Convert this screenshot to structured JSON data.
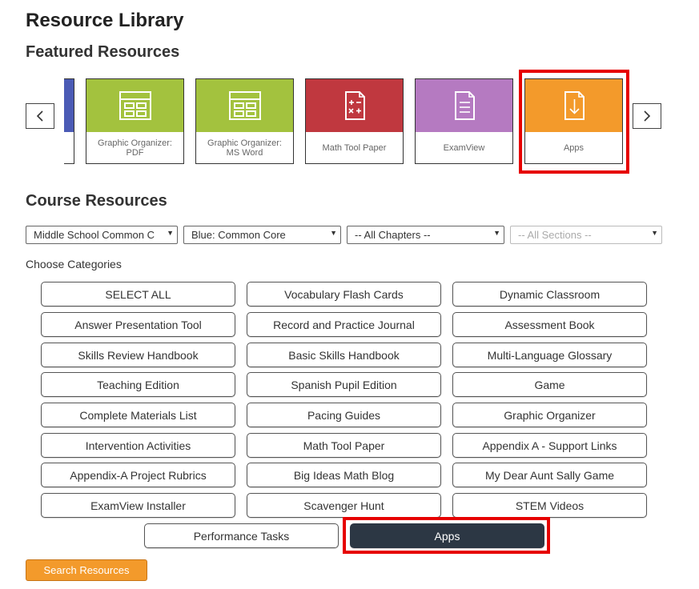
{
  "header": {
    "title": "Resource Library",
    "featured_title": "Featured Resources",
    "course_title": "Course Resources"
  },
  "featured": {
    "tiles": [
      {
        "label": "Graphic Organizer: PDF",
        "color": "#a3c23e",
        "icon": "table-grid-icon"
      },
      {
        "label": "Graphic Organizer: MS Word",
        "color": "#a3c23e",
        "icon": "table-grid-icon"
      },
      {
        "label": "Math Tool Paper",
        "color": "#c0383f",
        "icon": "math-operators-icon"
      },
      {
        "label": "ExamView",
        "color": "#b57ac1",
        "icon": "document-lines-icon"
      },
      {
        "label": "Apps",
        "color": "#f39a2b",
        "icon": "download-icon"
      }
    ],
    "partial_tile_color": "#4b5bb5"
  },
  "filters": {
    "course": "Middle School Common C",
    "program": "Blue: Common Core",
    "chapter": "-- All Chapters --",
    "section": "-- All Sections --"
  },
  "categories": {
    "label": "Choose Categories",
    "buttons": [
      "SELECT ALL",
      "Vocabulary Flash Cards",
      "Dynamic Classroom",
      "Answer Presentation Tool",
      "Record and Practice Journal",
      "Assessment Book",
      "Skills Review Handbook",
      "Basic Skills Handbook",
      "Multi-Language Glossary",
      "Teaching Edition",
      "Spanish Pupil Edition",
      "Game",
      "Complete Materials List",
      "Pacing Guides",
      "Graphic Organizer",
      "Intervention Activities",
      "Math Tool Paper",
      "Appendix A - Support Links",
      "Appendix-A Project Rubrics",
      "Big Ideas Math Blog",
      "My Dear Aunt Sally Game",
      "ExamView Installer",
      "Scavenger Hunt",
      "STEM Videos",
      "Performance Tasks",
      "Apps"
    ],
    "selected": "Apps"
  },
  "actions": {
    "search_label": "Search Resources"
  },
  "colors": {
    "highlight": "#e60000",
    "selected_button": "#2c3744",
    "search_button": "#f39a2b"
  }
}
